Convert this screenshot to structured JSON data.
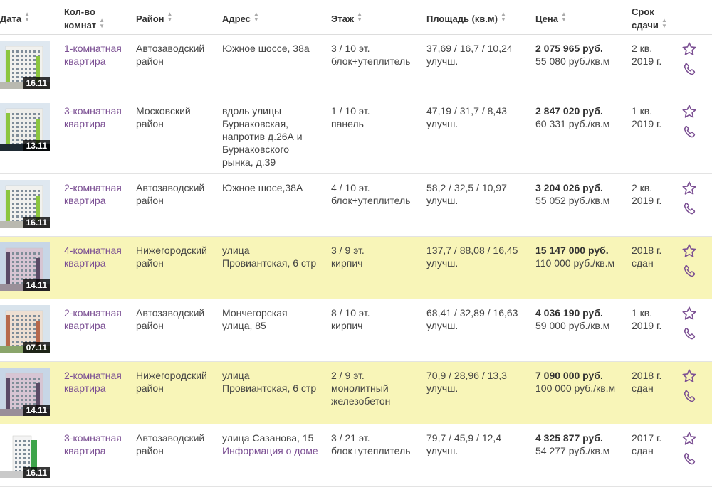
{
  "header": {
    "date": "Дата",
    "rooms": [
      "Кол-во",
      "комнат"
    ],
    "district": "Район",
    "address": "Адрес",
    "floor": "Этаж",
    "area": "Площадь (кв.м)",
    "price": "Цена",
    "deadline": [
      "Срок",
      "сдачи"
    ]
  },
  "colors": {
    "accent": "#7b4f93",
    "highlight_row": "#f8f5b8"
  },
  "icons": {
    "favorite": "star-icon",
    "call": "phone-icon"
  },
  "rows": [
    {
      "date": "16.11",
      "rooms": [
        "1-комнатная",
        "квартира"
      ],
      "district": [
        "Автозаводский",
        "район"
      ],
      "address": [
        "Южное шоссе, 38а"
      ],
      "floor": [
        "3 / 10 эт.",
        "блок+утеплитель"
      ],
      "area": [
        "37,69 / 16,7 / 10,24",
        "улучш."
      ],
      "price": "2 075 965 руб.",
      "price_per_m": "55 080 руб./кв.м",
      "deadline": [
        "2 кв.",
        "2019 г."
      ],
      "highlighted": false
    },
    {
      "date": "13.11",
      "rooms": [
        "3-комнатная",
        "квартира"
      ],
      "district": [
        "Московский",
        "район"
      ],
      "address": [
        "вдоль улицы",
        "Бурнаковская,",
        "напротив д.26А и",
        "Бурнаковского",
        "рынка, д.39"
      ],
      "floor": [
        "1 / 10 эт.",
        "панель"
      ],
      "area": [
        "47,19 / 31,7 / 8,43",
        "улучш."
      ],
      "price": "2 847 020 руб.",
      "price_per_m": "60 331 руб./кв.м",
      "deadline": [
        "1 кв.",
        "2019 г."
      ],
      "highlighted": false
    },
    {
      "date": "16.11",
      "rooms": [
        "2-комнатная",
        "квартира"
      ],
      "district": [
        "Автозаводский",
        "район"
      ],
      "address": [
        "Южное шосе,38А"
      ],
      "floor": [
        "4 / 10 эт.",
        "блок+утеплитель"
      ],
      "area": [
        "58,2 / 32,5 / 10,97",
        "улучш."
      ],
      "price": "3 204 026 руб.",
      "price_per_m": "55 052 руб./кв.м",
      "deadline": [
        "2 кв.",
        "2019 г."
      ],
      "highlighted": false
    },
    {
      "date": "14.11",
      "rooms": [
        "4-комнатная",
        "квартира"
      ],
      "district": [
        "Нижегородский",
        "район"
      ],
      "address": [
        "улица",
        "Провиантская, 6 стр"
      ],
      "floor": [
        "3 / 9 эт.",
        "кирпич"
      ],
      "area": [
        "137,7 / 88,08 / 16,45",
        "улучш."
      ],
      "price": "15 147 000 руб.",
      "price_per_m": "110 000 руб./кв.м",
      "deadline": [
        "2018 г.",
        "сдан"
      ],
      "highlighted": true
    },
    {
      "date": "07.11",
      "rooms": [
        "2-комнатная",
        "квартира"
      ],
      "district": [
        "Автозаводский",
        "район"
      ],
      "address": [
        "Мончегорская",
        "улица, 85"
      ],
      "floor": [
        "8 / 10 эт.",
        "кирпич"
      ],
      "area": [
        "68,41 / 32,89 / 16,63",
        "улучш."
      ],
      "price": "4 036 190 руб.",
      "price_per_m": "59 000 руб./кв.м",
      "deadline": [
        "1 кв.",
        "2019 г."
      ],
      "highlighted": false
    },
    {
      "date": "14.11",
      "rooms": [
        "2-комнатная",
        "квартира"
      ],
      "district": [
        "Нижегородский",
        "район"
      ],
      "address": [
        "улица",
        "Провиантская, 6 стр"
      ],
      "floor": [
        "2 / 9 эт.",
        "монолитный",
        "железобетон"
      ],
      "area": [
        "70,9 / 28,96 / 13,3",
        "улучш."
      ],
      "price": "7 090 000 руб.",
      "price_per_m": "100 000 руб./кв.м",
      "deadline": [
        "2018 г.",
        "сдан"
      ],
      "highlighted": true
    },
    {
      "date": "16.11",
      "rooms": [
        "3-комнатная",
        "квартира"
      ],
      "district": [
        "Автозаводский",
        "район"
      ],
      "address": [
        "улица Сазанова, 15"
      ],
      "address_link": "Информация о доме",
      "floor": [
        "3 / 21 эт.",
        "блок+утеплитель"
      ],
      "area": [
        "79,7 / 45,9 / 12,4",
        "улучш."
      ],
      "price": "4 325 877 руб.",
      "price_per_m": "54 277 руб./кв.м",
      "deadline": [
        "2017 г.",
        "сдан"
      ],
      "highlighted": false
    }
  ]
}
